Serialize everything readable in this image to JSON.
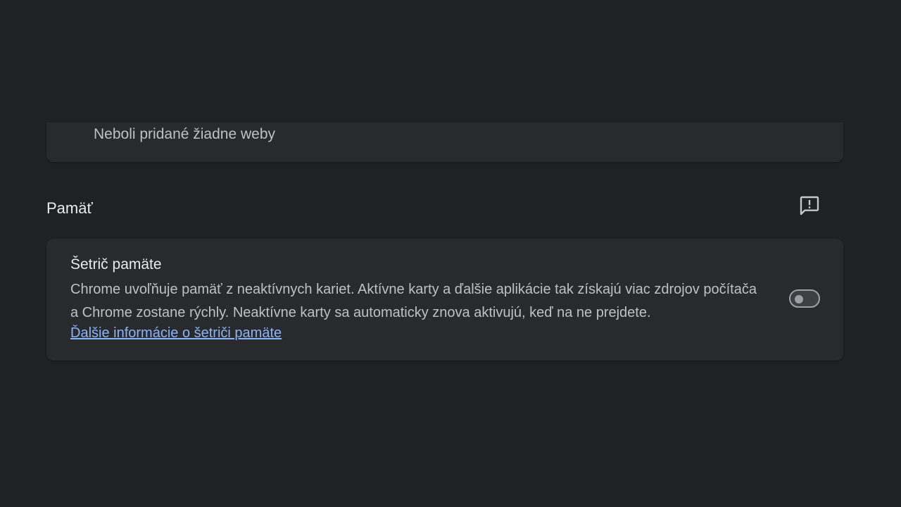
{
  "sites_section": {
    "empty_text": "Neboli pridané žiadne weby"
  },
  "memory_section": {
    "title": "Pamäť",
    "feedback_icon": "feedback-icon",
    "memory_saver": {
      "label": "Šetrič pamäte",
      "description": "Chrome uvoľňuje pamäť z neaktívnych kariet. Aktívne karty a ďalšie aplikácie tak získajú viac zdrojov počítača a Chrome zostane rýchly. Neaktívne karty sa automaticky znova aktivujú, keď na ne prejdete.",
      "link_text": "Ďalšie informácie o šetriči pamäte",
      "enabled": false
    }
  },
  "colors": {
    "background": "#202124",
    "card": "#292a2d",
    "link": "#8ab4f8"
  }
}
